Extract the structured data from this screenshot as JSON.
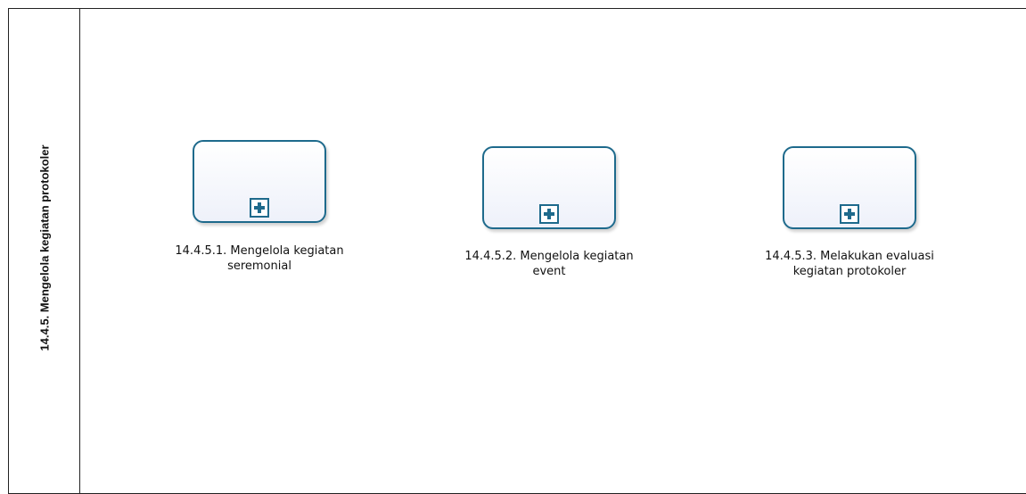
{
  "lane": {
    "title": "14.4.5. Mengelola kegiatan protokoler"
  },
  "tasks": [
    {
      "line1": "14.4.5.1. Mengelola kegiatan",
      "line2": "seremonial"
    },
    {
      "line1": "14.4.5.2. Mengelola kegiatan",
      "line2": "event"
    },
    {
      "line1": "14.4.5.3. Melakukan evaluasi",
      "line2": "kegiatan protokoler"
    }
  ],
  "colors": {
    "task_border": "#1e6a8c",
    "task_fill": "#eef1fa",
    "pool_border": "#222222"
  }
}
